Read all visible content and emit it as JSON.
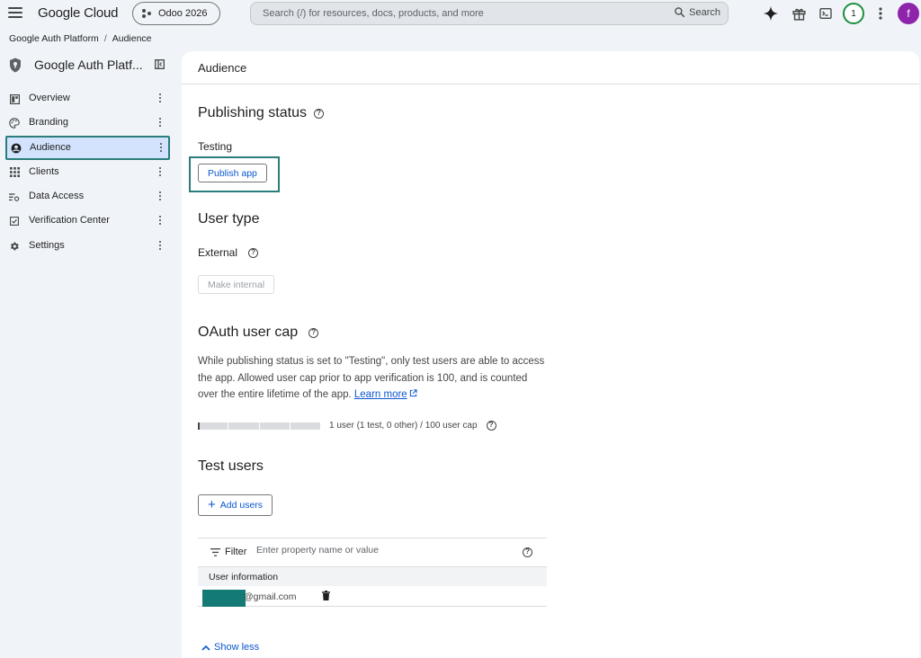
{
  "topbar": {
    "brand": "Google Cloud",
    "project": "Odoo 2026",
    "search_placeholder": "Search (/) for resources, docs, products, and more",
    "search_label": "Search",
    "notification_count": "1",
    "avatar_initial": "f"
  },
  "breadcrumb": [
    "Google Auth Platform",
    "Audience"
  ],
  "sidebar": {
    "title": "Google Auth Platf...",
    "items": [
      {
        "label": "Overview",
        "icon": "dashboard-icon"
      },
      {
        "label": "Branding",
        "icon": "palette-icon"
      },
      {
        "label": "Audience",
        "icon": "account-circle-icon",
        "active": true
      },
      {
        "label": "Clients",
        "icon": "apps-grid-icon"
      },
      {
        "label": "Data Access",
        "icon": "data-access-icon"
      },
      {
        "label": "Verification Center",
        "icon": "verified-box-icon"
      },
      {
        "label": "Settings",
        "icon": "gear-icon"
      }
    ]
  },
  "main": {
    "header": "Audience",
    "publishing": {
      "title": "Publishing status",
      "status": "Testing",
      "button": "Publish app"
    },
    "user_type": {
      "title": "User type",
      "value": "External",
      "button": "Make internal"
    },
    "oauth_cap": {
      "title": "OAuth user cap",
      "description": "While publishing status is set to \"Testing\", only test users are able to access the app. Allowed user cap prior to app verification is 100, and is counted over the entire lifetime of the app.",
      "learn_more": "Learn more",
      "usage_text": "1 user (1 test, 0 other) / 100 user cap",
      "usage_fraction": 0.01
    },
    "test_users": {
      "title": "Test users",
      "add_button": "Add users",
      "filter_label": "Filter",
      "filter_placeholder": "Enter property name or value",
      "column_header": "User information",
      "rows": [
        {
          "email_suffix": "@gmail.com"
        }
      ],
      "show_less": "Show less"
    }
  },
  "colors": {
    "accent": "#0b57d0",
    "highlight": "#2a7d7b",
    "active_nav": "#d3e3fd",
    "background": "#f0f4f9",
    "redaction": "#137a75"
  }
}
